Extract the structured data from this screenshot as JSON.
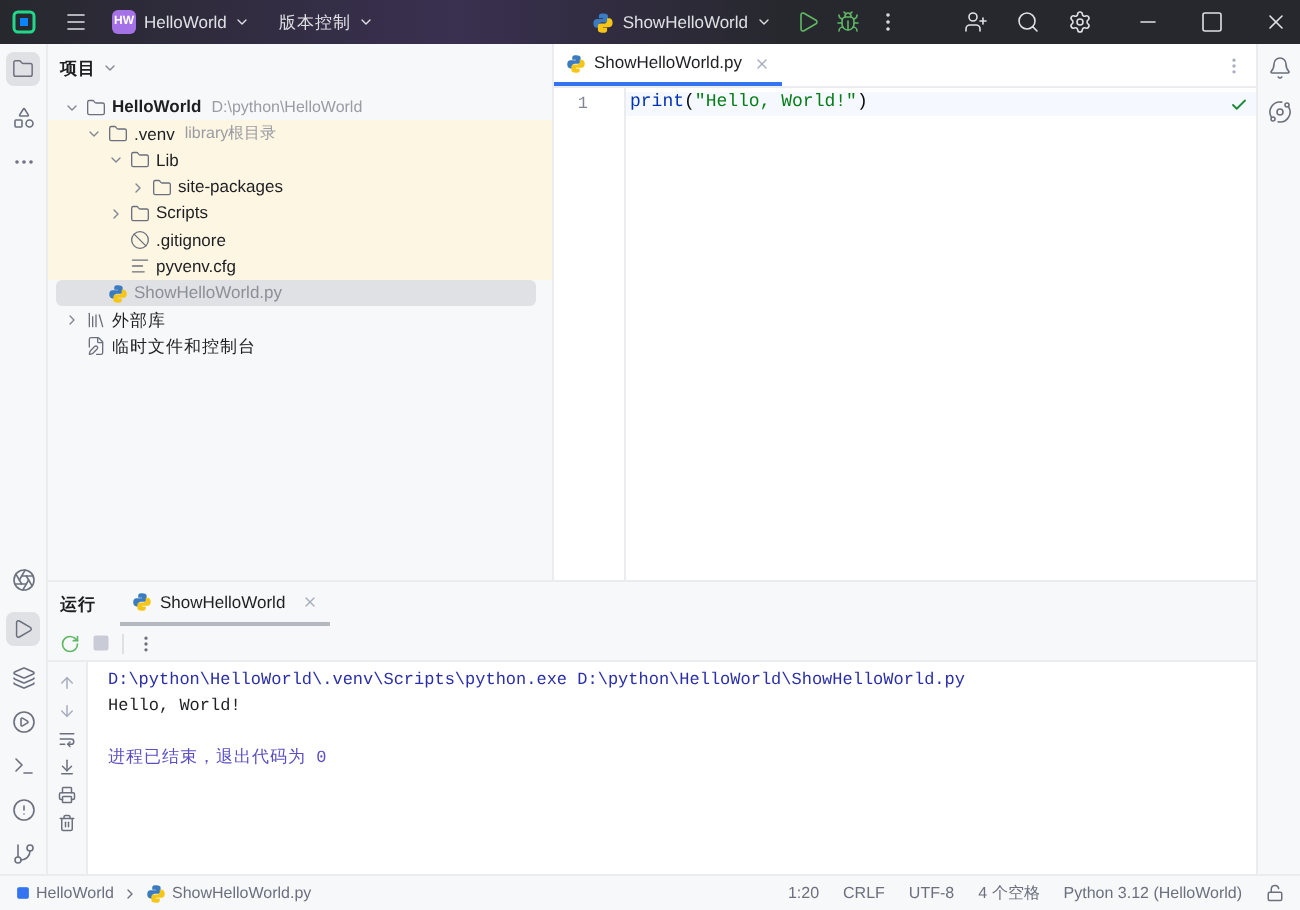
{
  "title_bar": {
    "badge": "HW",
    "project": "HelloWorld",
    "vcs": "版本控制",
    "run_config": "ShowHelloWorld"
  },
  "project_panel": {
    "title": "项目",
    "tree": [
      {
        "name": "HelloWorld",
        "hint": "D:\\python\\HelloWorld",
        "kind": "folder",
        "expanded": true,
        "bold": true,
        "excluded": false,
        "selected": false,
        "children": [
          {
            "name": ".venv",
            "hint": "library根目录",
            "kind": "folder",
            "expanded": true,
            "excluded": true,
            "selected": false,
            "children": [
              {
                "name": "Lib",
                "kind": "folder",
                "expanded": true,
                "excluded": true,
                "selected": false,
                "children": [
                  {
                    "name": "site-packages",
                    "kind": "folder",
                    "expanded": false,
                    "excluded": true,
                    "selected": false
                  }
                ]
              },
              {
                "name": "Scripts",
                "kind": "folder",
                "expanded": false,
                "excluded": true,
                "selected": false
              },
              {
                "name": ".gitignore",
                "kind": "ignore",
                "excluded": true,
                "selected": false
              },
              {
                "name": "pyvenv.cfg",
                "kind": "config",
                "excluded": true,
                "selected": false
              }
            ]
          },
          {
            "name": "ShowHelloWorld.py",
            "kind": "python",
            "excluded": false,
            "selected": true
          }
        ]
      },
      {
        "name": "外部库",
        "kind": "library",
        "expanded": false,
        "excluded": false,
        "selected": false
      },
      {
        "name": "临时文件和控制台",
        "kind": "scratch",
        "excluded": false,
        "selected": false
      }
    ]
  },
  "editor": {
    "tabs": [
      {
        "label": "ShowHelloWorld.py",
        "selected": true
      }
    ],
    "lines": [
      {
        "number": "1",
        "tokens": [
          {
            "text": "print",
            "kind": "builtin"
          },
          {
            "text": "(",
            "kind": "plain"
          },
          {
            "text": "\"Hello, World!\"",
            "kind": "string"
          },
          {
            "text": ")",
            "kind": "plain"
          }
        ]
      }
    ]
  },
  "run_panel": {
    "title": "运行",
    "tabs": [
      {
        "label": "ShowHelloWorld",
        "selected": true
      }
    ],
    "console": [
      {
        "text": "D:\\python\\HelloWorld\\.venv\\Scripts\\python.exe D:\\python\\HelloWorld\\ShowHelloWorld.py",
        "kind": "command"
      },
      {
        "text": "Hello, World!",
        "kind": "output"
      },
      {
        "text": "进程已结束，退出代码为 0",
        "kind": "status"
      }
    ]
  },
  "status_bar": {
    "breadcrumb": [
      "HelloWorld",
      "ShowHelloWorld.py"
    ],
    "items": [
      "1:20",
      "CRLF",
      "UTF-8",
      "4 个空格",
      "Python 3.12 (HelloWorld)"
    ]
  }
}
